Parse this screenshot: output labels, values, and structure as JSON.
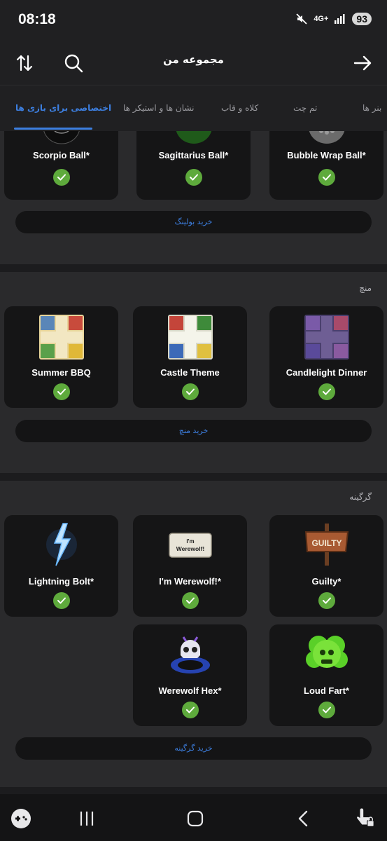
{
  "status": {
    "time": "08:18",
    "network": "4G+",
    "battery": "93"
  },
  "header": {
    "title": "مجموعه من"
  },
  "tabs": [
    {
      "label": "اختصاصی برای بازی ها",
      "active": true
    },
    {
      "label": "نشان ها و استیکر ها",
      "active": false
    },
    {
      "label": "کلاه و قاب",
      "active": false
    },
    {
      "label": "تم چت",
      "active": false
    },
    {
      "label": "بنر ها",
      "active": false
    }
  ],
  "bowling": {
    "items": [
      {
        "name": "Scorpio Ball*",
        "owned": true
      },
      {
        "name": "Sagittarius Ball*",
        "owned": true
      },
      {
        "name": "Bubble Wrap Ball*",
        "owned": true
      }
    ],
    "buy_label": "خرید بولینگ"
  },
  "ludo": {
    "section_title": "منچ",
    "items": [
      {
        "name": "Summer BBQ",
        "owned": true
      },
      {
        "name": "Castle Theme",
        "owned": true
      },
      {
        "name": "Candlelight Dinner",
        "owned": true
      }
    ],
    "buy_label": "خرید منچ"
  },
  "werewolf": {
    "section_title": "گرگینه",
    "items": [
      {
        "name": "Lightning Bolt*",
        "owned": true
      },
      {
        "name": "I'm Werewolf!*",
        "owned": true,
        "sign_text": "I'm Werewolf!"
      },
      {
        "name": "Guilty*",
        "owned": true,
        "sign_text": "GUILTY"
      },
      {
        "name": "Werewolf Hex*",
        "owned": true
      },
      {
        "name": "Loud Fart*",
        "owned": true
      }
    ],
    "buy_label": "خرید گرگینه"
  },
  "colors": {
    "accent": "#3d7fe0",
    "check": "#5eaa3c",
    "card": "#151516",
    "section": "#2a2a2c"
  },
  "nav": [
    "gamepad-icon",
    "recent-apps-icon",
    "home-icon",
    "back-icon",
    "accessibility-icon"
  ]
}
